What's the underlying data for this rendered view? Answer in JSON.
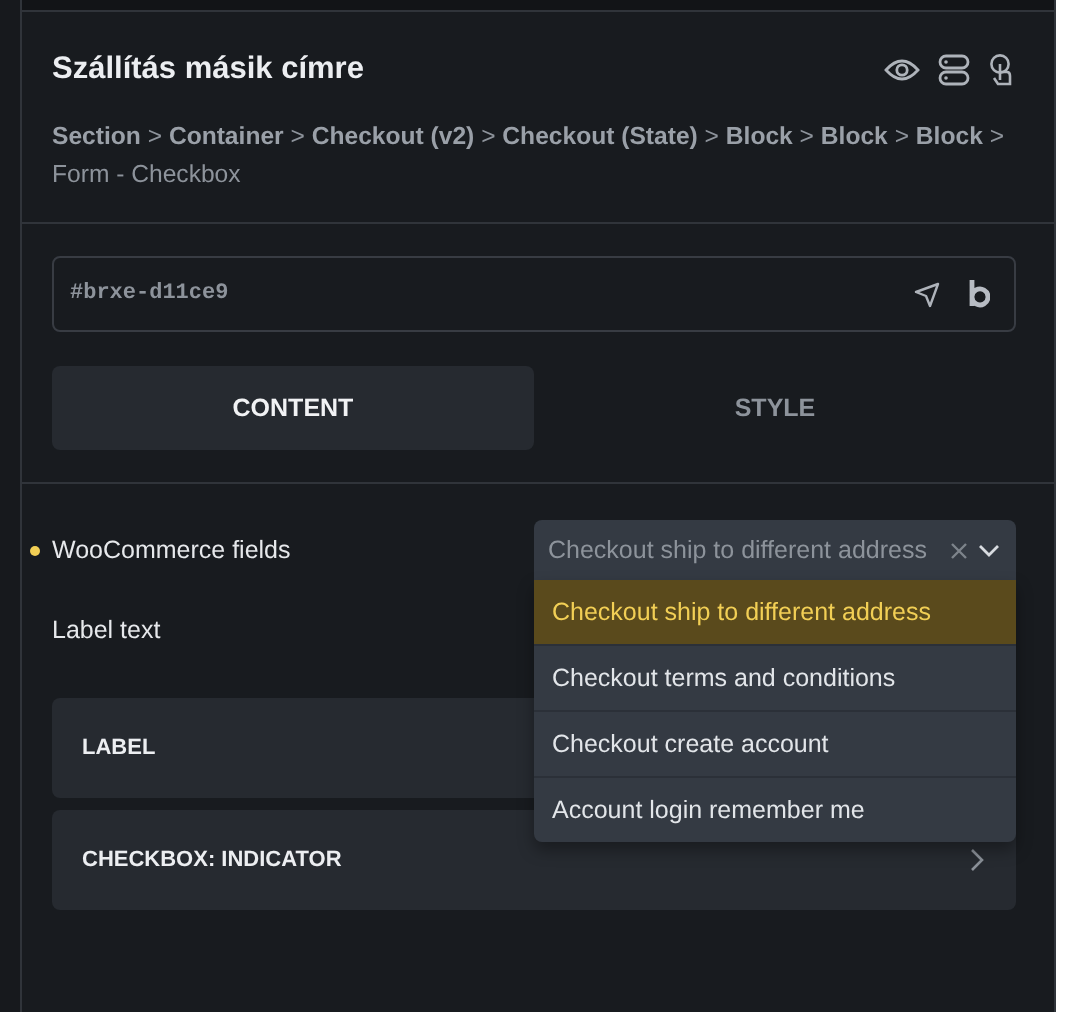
{
  "header": {
    "title": "Szállítás másik címre",
    "breadcrumb": "**Section** > **Container** > **Checkout (v2)** > **Checkout (State)** > **Block** > **Block** > **Block** > Form - Checkbox"
  },
  "id_field": {
    "value": "#brxe-d11ce9"
  },
  "tabs": [
    {
      "label": "CONTENT",
      "selected": true
    },
    {
      "label": "STYLE",
      "selected": false
    }
  ],
  "fields": [
    {
      "label": "WooCommerce fields",
      "modified": true,
      "kind": "select",
      "value": "Checkout ship to different address",
      "options": [
        {
          "label": "Checkout ship to different address",
          "selected": true
        },
        {
          "label": "Checkout terms and conditions",
          "selected": false
        },
        {
          "label": "Checkout create account",
          "selected": false
        },
        {
          "label": "Account login remember me",
          "selected": false
        }
      ]
    },
    {
      "label": "Label text",
      "modified": false,
      "kind": "text"
    }
  ],
  "groups": [
    {
      "label": "LABEL"
    },
    {
      "label": "CHECKBOX: INDICATOR",
      "expanded": false
    }
  ]
}
